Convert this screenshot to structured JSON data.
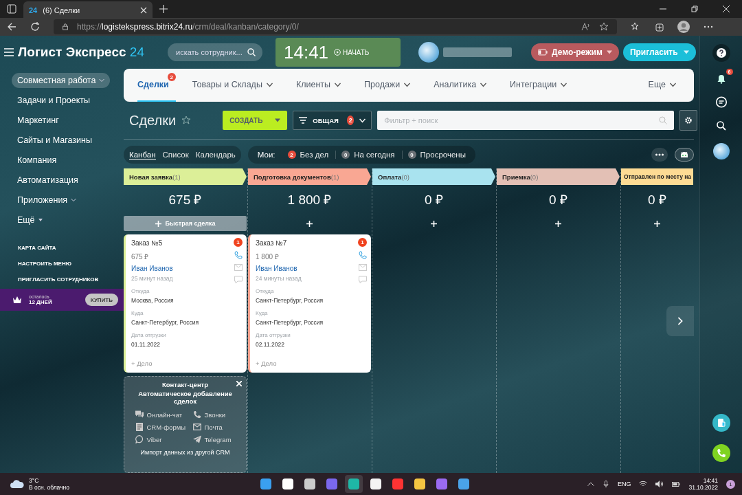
{
  "browser": {
    "favicon_text": "24",
    "tab_title": "(6) Сделки",
    "url_scheme": "https://",
    "url_host": "logistekspress.bitrix24.ru",
    "url_path": "/crm/deal/kanban/category/0/"
  },
  "header": {
    "logo_text": "Логист Экспресс",
    "logo_number": "24",
    "search_placeholder": "искать сотрудник...",
    "clock": "14:41",
    "start_label": "НАЧАТЬ",
    "demo_label": "Демо-режим",
    "invite_label": "Пригласить"
  },
  "sidebar": {
    "items": [
      {
        "label": "Совместная работа",
        "selected": true,
        "dropdown": true
      },
      {
        "label": "Задачи и Проекты",
        "selected": false
      },
      {
        "label": "Маркетинг",
        "selected": false
      },
      {
        "label": "Сайты и Магазины",
        "selected": false
      },
      {
        "label": "Компания",
        "selected": false
      },
      {
        "label": "Автоматизация",
        "selected": false
      },
      {
        "label": "Приложения",
        "selected": false,
        "dropdown": true
      },
      {
        "label": "Ещё",
        "selected": false,
        "dropdown_caret": true
      }
    ],
    "links": [
      "КАРТА САЙТА",
      "НАСТРОИТЬ МЕНЮ",
      "ПРИГЛАСИТЬ СОТРУДНИКОВ"
    ],
    "trial": {
      "remaining_label": "осталось",
      "days": "12 ДНЕЙ",
      "buy_label": "КУПИТЬ"
    }
  },
  "top_nav": {
    "items": [
      {
        "label": "Сделки",
        "selected": true,
        "badge": "2"
      },
      {
        "label": "Товары и Склады",
        "selected": false,
        "dropdown": true
      },
      {
        "label": "Клиенты",
        "selected": false,
        "dropdown": true
      },
      {
        "label": "Продажи",
        "selected": false,
        "dropdown": true
      },
      {
        "label": "Аналитика",
        "selected": false,
        "dropdown": true
      },
      {
        "label": "Интеграции",
        "selected": false,
        "dropdown": true
      }
    ],
    "more_label": "Еще"
  },
  "toolbar": {
    "title": "Сделки",
    "create_label": "СОЗДАТЬ",
    "filter_preset": "ОБЩАЯ",
    "filter_badge": "2",
    "search_placeholder": "Фильтр + поиск"
  },
  "views": [
    {
      "label": "Канбан",
      "selected": true
    },
    {
      "label": "Список",
      "selected": false
    },
    {
      "label": "Календарь",
      "selected": false
    }
  ],
  "counters": {
    "label": "Мои:",
    "items": [
      {
        "count": "2",
        "label": "Без дел",
        "alert": true
      },
      {
        "count": "0",
        "label": "На сегодня",
        "alert": false
      },
      {
        "count": "0",
        "label": "Просрочены",
        "alert": false
      }
    ]
  },
  "columns": [
    {
      "name": "Новая заявка",
      "count": "(1)",
      "color": "#dcef98",
      "total": "675 ₽",
      "quick_label": "Быстрая сделка",
      "cards": [
        {
          "title": "Заказ №5",
          "amount": "675 ₽",
          "contact": "Иван Иванов",
          "time": "25 минут назад",
          "badge": "1",
          "add_activity": "+ Дело",
          "fields": [
            {
              "label": "Откуда",
              "value": "Москва, Россия"
            },
            {
              "label": "Куда",
              "value": "Санкт-Петербург, Россия"
            },
            {
              "label": "Дата отгрузки",
              "value": "01.11.2022"
            }
          ]
        }
      ]
    },
    {
      "name": "Подготовка документов",
      "count": "(1)",
      "color": "#f9a793",
      "total": "1 800 ₽",
      "cards": [
        {
          "title": "Заказ №7",
          "amount": "1 800 ₽",
          "contact": "Иван Иванов",
          "time": "24 минуты назад",
          "badge": "1",
          "add_activity": "+ Дело",
          "fields": [
            {
              "label": "Откуда",
              "value": "Санкт-Петербург, Россия"
            },
            {
              "label": "Куда",
              "value": "Санкт-Петербург, Россия"
            },
            {
              "label": "Дата отгрузки",
              "value": "02.11.2022"
            }
          ]
        }
      ]
    },
    {
      "name": "Оплата",
      "count": "(0)",
      "color": "#a9e3ef",
      "total": "0 ₽"
    },
    {
      "name": "Приемка",
      "count": "(0)",
      "color": "#e3c0b5",
      "total": "0 ₽"
    },
    {
      "name": "Отправлен по месту на",
      "color": "#fddb94",
      "total": "0 ₽"
    }
  ],
  "promo": {
    "title": "Контакт-центр",
    "subtitle": "Автоматическое добавление сделок",
    "channels": [
      {
        "label": "Онлайн-чат",
        "kind": "chat"
      },
      {
        "label": "Звонки",
        "kind": "call"
      },
      {
        "label": "CRM-формы",
        "kind": "form"
      },
      {
        "label": "Почта",
        "kind": "mail"
      },
      {
        "label": "Viber",
        "kind": "viber"
      },
      {
        "label": "Telegram",
        "kind": "telegram"
      }
    ],
    "footer": "Импорт данных из другой CRM"
  },
  "right_rail": {
    "notifications": "6"
  },
  "taskbar": {
    "temperature": "3°C",
    "weather": "В осн. облачно",
    "language": "ENG",
    "time": "14:41",
    "date": "31.10.2022",
    "notifications": "1"
  }
}
